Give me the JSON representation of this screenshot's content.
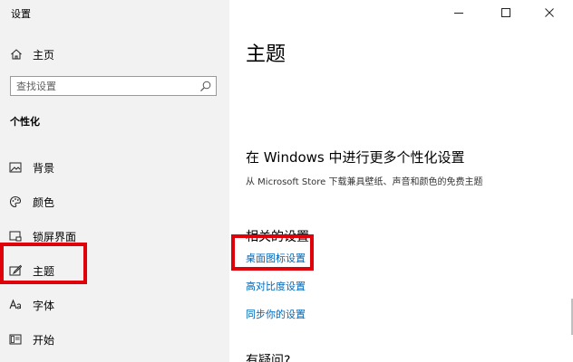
{
  "window": {
    "title": "设置",
    "controls": [
      "minimize-icon",
      "maximize-icon",
      "close-icon"
    ]
  },
  "sidebar": {
    "home_label": "主页",
    "search": {
      "placeholder": "查找设置",
      "value": ""
    },
    "section_heading": "个性化",
    "items": [
      {
        "icon": "background-icon",
        "label": "背景",
        "selected": false
      },
      {
        "icon": "color-palette-icon",
        "label": "颜色",
        "selected": false
      },
      {
        "icon": "lock-screen-icon",
        "label": "锁屏界面",
        "selected": false
      },
      {
        "icon": "themes-brush-icon",
        "label": "主题",
        "selected": true
      },
      {
        "icon": "font-icon",
        "label": "字体",
        "selected": false
      },
      {
        "icon": "start-menu-icon",
        "label": "开始",
        "selected": false
      }
    ]
  },
  "main": {
    "page_title": "主题",
    "store_heading": "在 Windows 中进行更多个性化设置",
    "store_desc": "从 Microsoft Store 下载兼具壁纸、声音和颜色的免费主题",
    "related_heading": "相关的设置",
    "related_links": [
      "桌面图标设置",
      "高对比度设置",
      "同步你的设置"
    ],
    "next_heading": "有疑问?"
  },
  "annotations": {
    "highlight_color": "#e0000a"
  }
}
